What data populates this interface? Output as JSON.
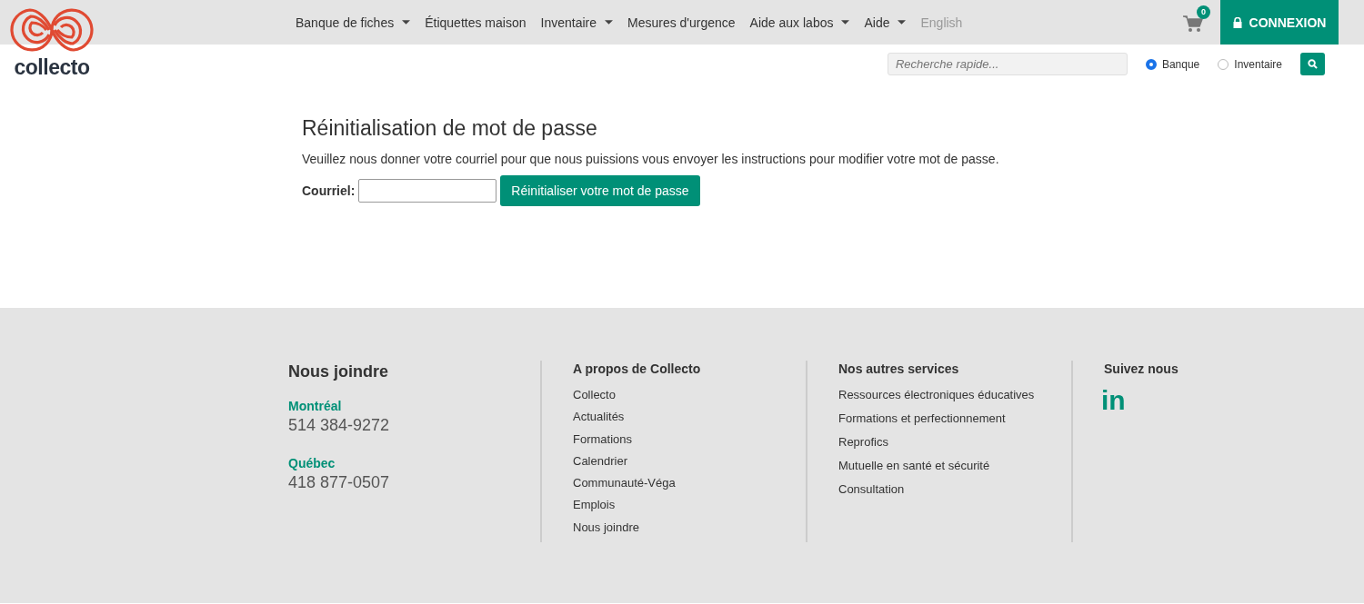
{
  "logo": {
    "wordmark": "collecto"
  },
  "nav": [
    {
      "label": "Banque de fiches",
      "has_menu": true,
      "disabled": false
    },
    {
      "label": "Étiquettes maison",
      "has_menu": false,
      "disabled": false
    },
    {
      "label": "Inventaire",
      "has_menu": true,
      "disabled": false
    },
    {
      "label": "Mesures d'urgence",
      "has_menu": false,
      "disabled": false
    },
    {
      "label": "Aide aux labos",
      "has_menu": true,
      "disabled": false
    },
    {
      "label": "Aide",
      "has_menu": true,
      "disabled": false
    },
    {
      "label": "English",
      "has_menu": false,
      "disabled": true
    }
  ],
  "cart": {
    "count": "0"
  },
  "login_button": "CONNEXION",
  "search": {
    "placeholder": "Recherche rapide...",
    "scopes": [
      {
        "label": "Banque",
        "selected": true
      },
      {
        "label": "Inventaire",
        "selected": false
      }
    ]
  },
  "main": {
    "title": "Réinitialisation de mot de passe",
    "intro": "Veuillez nous donner votre courriel pour que nous puissions vous envoyer les instructions pour modifier votre mot de passe.",
    "email_label": "Courriel:",
    "submit": "Réinitialiser votre mot de passe"
  },
  "footer": {
    "contact": {
      "heading": "Nous joindre",
      "offices": [
        {
          "city": "Montréal",
          "phone": "514 384-9272"
        },
        {
          "city": "Québec",
          "phone": "418 877-0507"
        }
      ]
    },
    "link_columns": [
      {
        "heading": "A propos de Collecto",
        "links": [
          "Collecto",
          "Actualités",
          "Formations",
          "Calendrier",
          "Communauté-Véga",
          "Emplois",
          "Nous joindre"
        ]
      },
      {
        "heading": "Nos autres services",
        "links": [
          "Ressources électroniques éducatives",
          "Formations et perfectionnement",
          "Reprofics",
          "Mutuelle en santé et sécurité",
          "Consultation"
        ]
      }
    ],
    "social": {
      "heading": "Suivez nous",
      "icon_text": "in"
    }
  }
}
